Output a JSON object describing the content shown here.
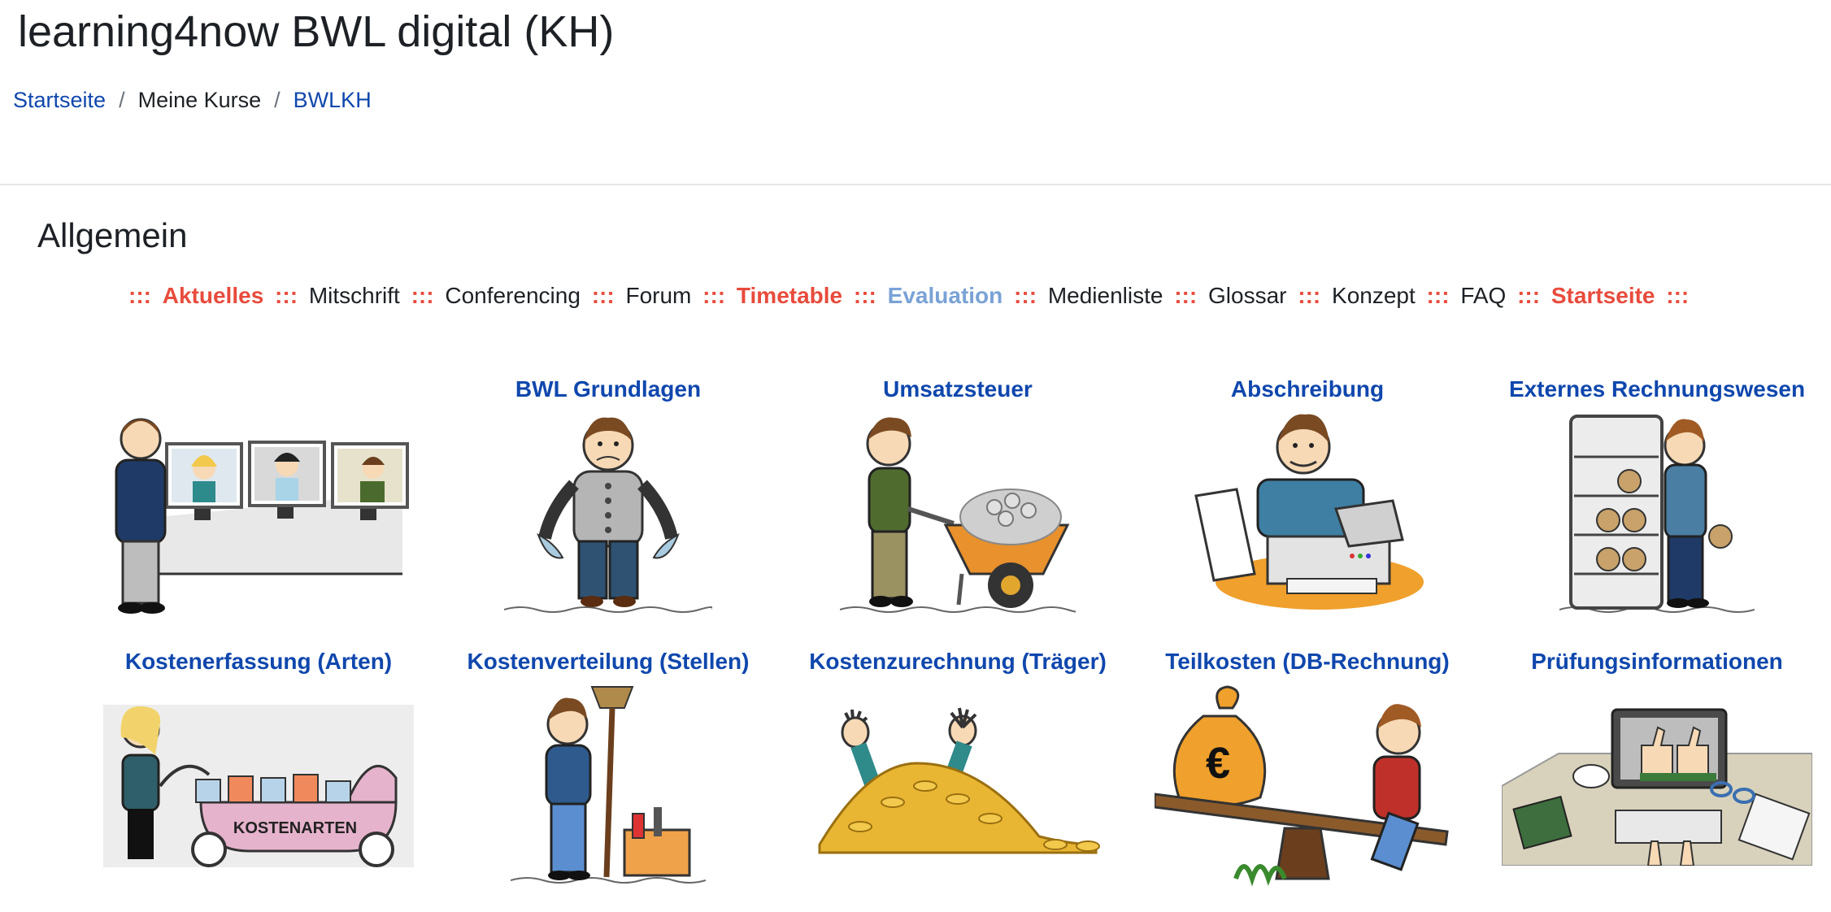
{
  "header": {
    "title": "learning4now BWL digital (KH)",
    "breadcrumb": [
      {
        "label": "Startseite",
        "link": true
      },
      {
        "label": "Meine Kurse",
        "link": false
      },
      {
        "label": "BWLKH",
        "link": true
      }
    ],
    "separator": "/"
  },
  "section": {
    "title": "Allgemein",
    "nav_separator": ":::",
    "nav": [
      {
        "label": "Aktuelles",
        "style": "red"
      },
      {
        "label": "Mitschrift",
        "style": "normal"
      },
      {
        "label": "Conferencing",
        "style": "normal"
      },
      {
        "label": "Forum",
        "style": "normal"
      },
      {
        "label": "Timetable",
        "style": "red"
      },
      {
        "label": "Evaluation",
        "style": "blue"
      },
      {
        "label": "Medienliste",
        "style": "normal"
      },
      {
        "label": "Glossar",
        "style": "normal"
      },
      {
        "label": "Konzept",
        "style": "normal"
      },
      {
        "label": "FAQ",
        "style": "normal"
      },
      {
        "label": "Startseite",
        "style": "red"
      }
    ]
  },
  "tiles": [
    {
      "title": "",
      "icon": "video-conference-icon"
    },
    {
      "title": "BWL Grundlagen",
      "icon": "empty-pockets-icon"
    },
    {
      "title": "Umsatzsteuer",
      "icon": "wheelbarrow-coins-icon"
    },
    {
      "title": "Abschreibung",
      "icon": "printer-icon"
    },
    {
      "title": "Externes Rechnungswesen",
      "icon": "money-shelf-icon"
    },
    {
      "title": "Kostenerfassung (Arten)",
      "icon": "kostenarten-pram-icon"
    },
    {
      "title": "Kostenverteilung (Stellen)",
      "icon": "broom-toolbox-icon"
    },
    {
      "title": "Kostenzurechnung (Träger)",
      "icon": "coin-pile-icon"
    },
    {
      "title": "Teilkosten (DB-Rechnung)",
      "icon": "seesaw-moneybag-icon"
    },
    {
      "title": "Prüfungsinformationen",
      "icon": "thumbs-up-laptop-icon"
    }
  ],
  "illustration_text": {
    "pram_label": "KOSTENARTEN",
    "euro_symbol": "€"
  },
  "colors": {
    "link": "#0f47ad",
    "accent_red": "#e84b3c",
    "evaluation_blue": "#7aa2d6"
  }
}
